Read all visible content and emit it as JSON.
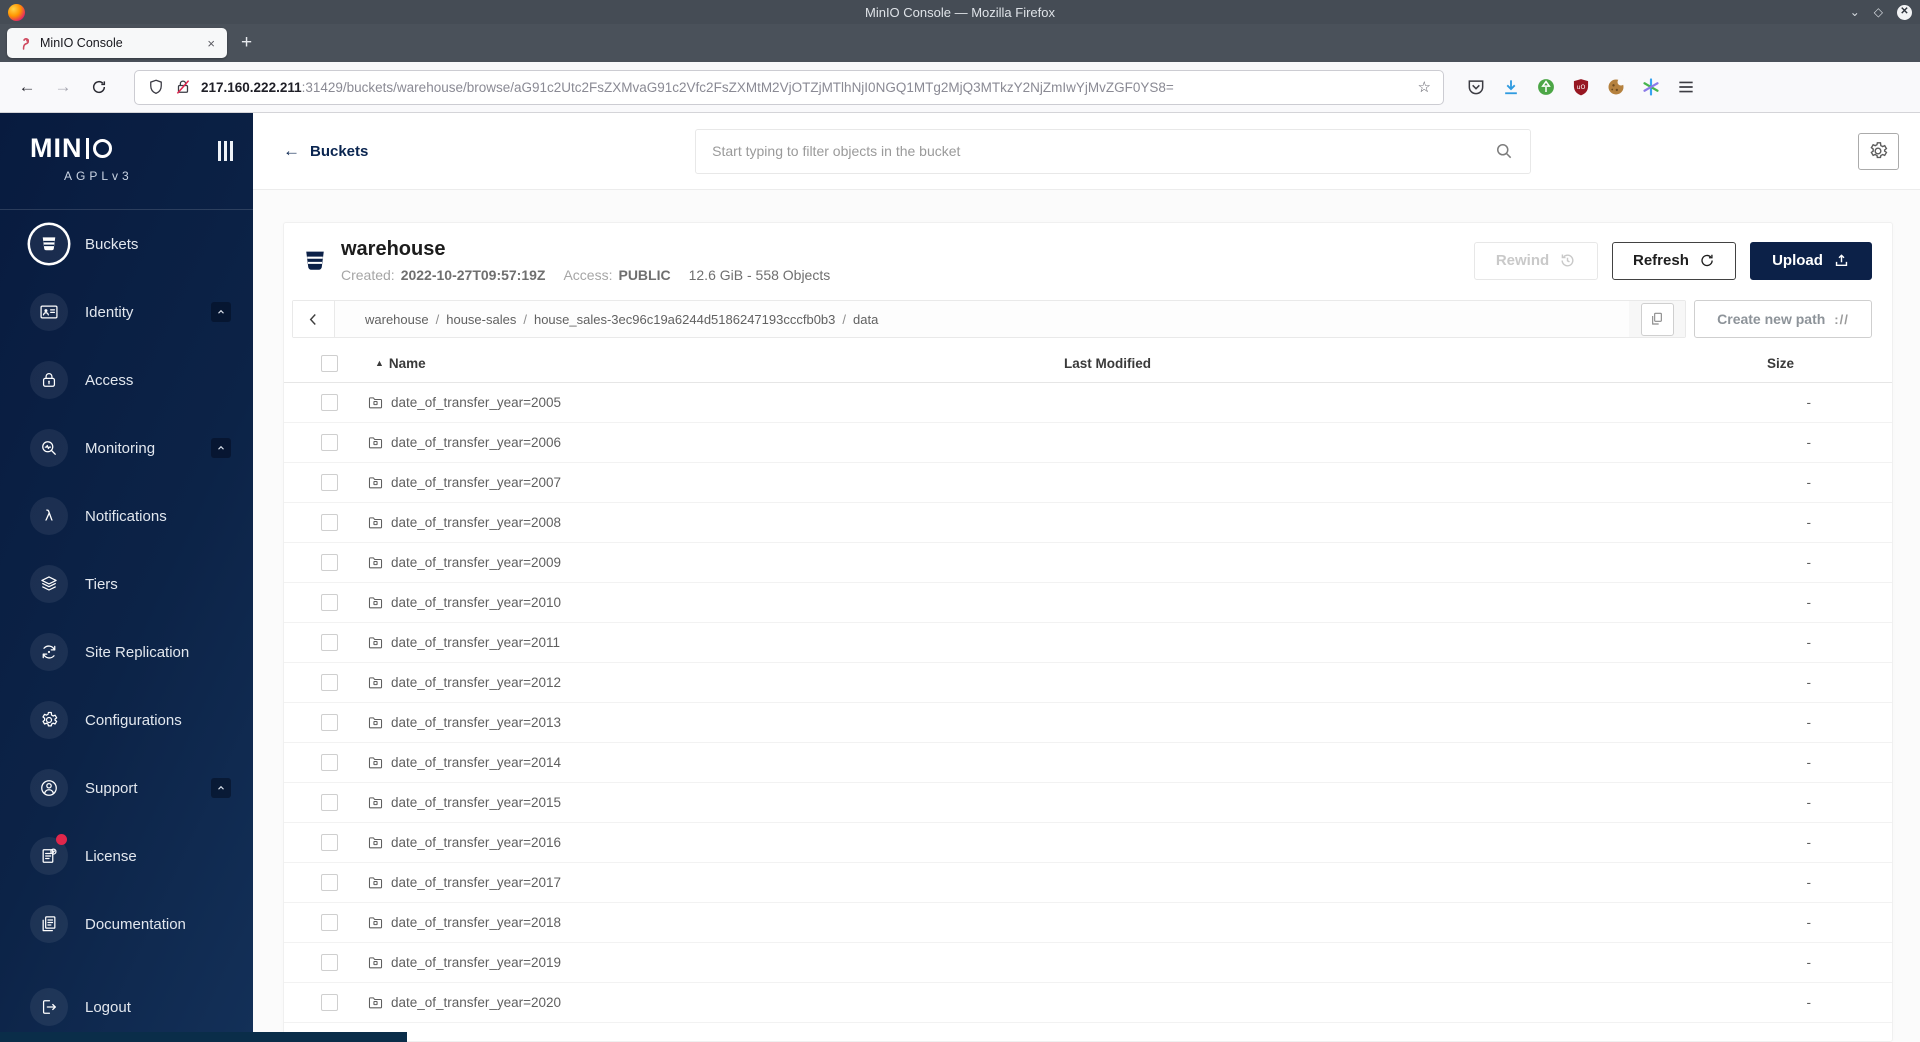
{
  "window": {
    "title": "MinIO Console — Mozilla Firefox",
    "controls": [
      "minimize-icon",
      "maximize-icon",
      "close-icon"
    ]
  },
  "browser": {
    "tab_title": "MinIO Console",
    "close_tab": "×",
    "new_tab": "+",
    "url_host": "217.160.222.211",
    "url_path": ":31429/buckets/warehouse/browse/aG91c2Utc2FsZXMvaG91c2Vfc2FsZXMtM2VjOTZjMTlhNjI0NGQ1MTg2MjQ3MTkzY2NjZmIwYjMvZGF0YS8=",
    "toolbar_icons": [
      "pocket-icon",
      "download-icon",
      "privacy-badger-icon",
      "ublock-icon",
      "cookie-icon",
      "container-icon",
      "menu-icon"
    ]
  },
  "sidebar": {
    "logo_text": "MINIO",
    "license_tag": "AGPLv3",
    "items": [
      {
        "label": "Buckets",
        "icon": "bucket-icon",
        "selected": true
      },
      {
        "label": "Identity",
        "icon": "identity-card-icon",
        "expandable": true
      },
      {
        "label": "Access",
        "icon": "lock-icon"
      },
      {
        "label": "Monitoring",
        "icon": "monitoring-search-icon",
        "expandable": true
      },
      {
        "label": "Notifications",
        "icon": "lambda-icon"
      },
      {
        "label": "Tiers",
        "icon": "layers-icon"
      },
      {
        "label": "Site Replication",
        "icon": "replication-icon"
      },
      {
        "label": "Configurations",
        "icon": "gear-icon"
      },
      {
        "label": "Support",
        "icon": "support-icon",
        "expandable": true
      },
      {
        "label": "License",
        "icon": "license-icon",
        "badge": true
      },
      {
        "label": "Documentation",
        "icon": "documentation-icon"
      },
      {
        "label": "Logout",
        "icon": "logout-icon",
        "spacer_before": true
      }
    ]
  },
  "header": {
    "back_label": "Buckets",
    "search_placeholder": "Start typing to filter objects in the bucket"
  },
  "bucket": {
    "name": "warehouse",
    "created_label": "Created:",
    "created_value": "2022-10-27T09:57:19Z",
    "access_label": "Access:",
    "access_value": "PUBLIC",
    "summary": "12.6 GiB - 558 Objects",
    "rewind_label": "Rewind",
    "refresh_label": "Refresh",
    "upload_label": "Upload"
  },
  "browse": {
    "breadcrumb": [
      "warehouse",
      "house-sales",
      "house_sales-3ec96c19a6244d5186247193cccfb0b3",
      "data"
    ],
    "separator": "/",
    "create_new_path_label": "Create new path",
    "create_path_glyph": "://"
  },
  "table": {
    "columns": [
      "Name",
      "Last Modified",
      "Size"
    ],
    "sort_indicator": "▲",
    "rows": [
      {
        "name": "date_of_transfer_year=2005",
        "modified": "",
        "size": "-"
      },
      {
        "name": "date_of_transfer_year=2006",
        "modified": "",
        "size": "-"
      },
      {
        "name": "date_of_transfer_year=2007",
        "modified": "",
        "size": "-"
      },
      {
        "name": "date_of_transfer_year=2008",
        "modified": "",
        "size": "-"
      },
      {
        "name": "date_of_transfer_year=2009",
        "modified": "",
        "size": "-"
      },
      {
        "name": "date_of_transfer_year=2010",
        "modified": "",
        "size": "-"
      },
      {
        "name": "date_of_transfer_year=2011",
        "modified": "",
        "size": "-"
      },
      {
        "name": "date_of_transfer_year=2012",
        "modified": "",
        "size": "-"
      },
      {
        "name": "date_of_transfer_year=2013",
        "modified": "",
        "size": "-"
      },
      {
        "name": "date_of_transfer_year=2014",
        "modified": "",
        "size": "-"
      },
      {
        "name": "date_of_transfer_year=2015",
        "modified": "",
        "size": "-"
      },
      {
        "name": "date_of_transfer_year=2016",
        "modified": "",
        "size": "-"
      },
      {
        "name": "date_of_transfer_year=2017",
        "modified": "",
        "size": "-"
      },
      {
        "name": "date_of_transfer_year=2018",
        "modified": "",
        "size": "-"
      },
      {
        "name": "date_of_transfer_year=2019",
        "modified": "",
        "size": "-"
      },
      {
        "name": "date_of_transfer_year=2020",
        "modified": "",
        "size": "-"
      }
    ]
  },
  "colors": {
    "accent_navy": "#0c2148",
    "sidebar_top": "#081b3f",
    "sidebar_bottom": "#133058",
    "badge_red": "#e0274b",
    "download_blue": "#2f9be0"
  }
}
